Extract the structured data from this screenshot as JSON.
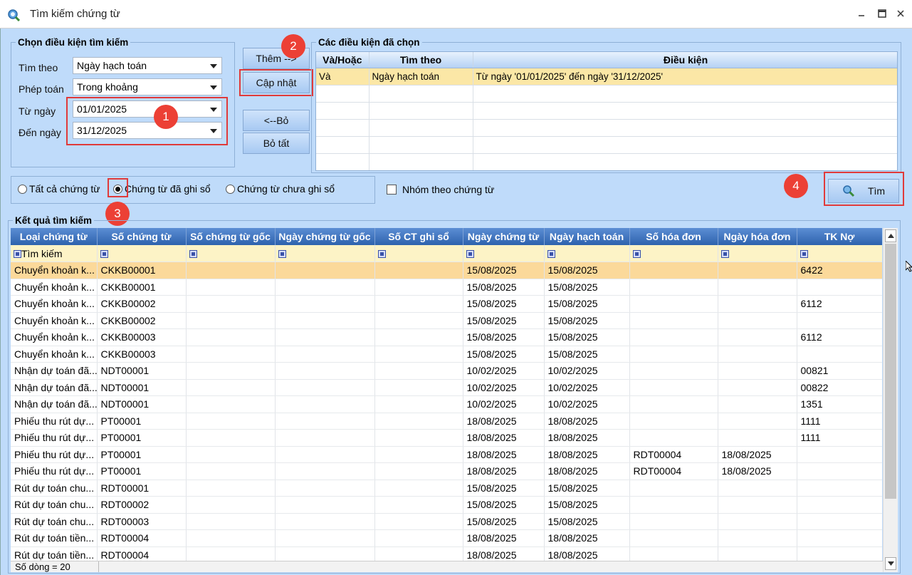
{
  "window": {
    "title": "Tìm kiếm chứng từ"
  },
  "criteria": {
    "legend": "Chọn điều kiện tìm kiếm",
    "tim_theo_label": "Tìm theo",
    "tim_theo_value": "Ngày hạch toán",
    "phep_toan_label": "Phép toán",
    "phep_toan_value": "Trong khoảng",
    "tu_ngay_label": "Từ ngày",
    "tu_ngay_value": "01/01/2025",
    "den_ngay_label": "Đến ngày",
    "den_ngay_value": "31/12/2025"
  },
  "buttons": {
    "them": "Thêm -->",
    "cap_nhat": "Cập nhật",
    "bo": "<--Bỏ",
    "bo_tat": "Bỏ tất",
    "tim": "Tìm"
  },
  "chosen": {
    "legend": "Các điều kiện đã chọn",
    "headers": [
      "Và/Hoặc",
      "Tìm theo",
      "Điều kiện"
    ],
    "rows": [
      [
        "Và",
        "Ngày hạch toán",
        "Từ ngày '01/01/2025' đến ngày '31/12/2025'"
      ]
    ]
  },
  "filter_options": {
    "all": "Tất cả chứng từ",
    "posted": "Chứng từ đã ghi sổ",
    "unposted": "Chứng từ chưa ghi sổ",
    "group": "Nhóm theo chứng từ",
    "selected": "posted"
  },
  "badges": [
    "1",
    "2",
    "3",
    "4"
  ],
  "results": {
    "legend": "Kết quả tìm kiếm",
    "headers": [
      "Loại chứng từ",
      "Số chứng từ",
      "Số chứng từ gốc",
      "Ngày chứng từ gốc",
      "Số CT ghi sổ",
      "Ngày chứng từ",
      "Ngày hạch toán",
      "Số hóa đơn",
      "Ngày hóa đơn",
      "TK Nợ"
    ],
    "filter_label": "Tìm kiếm",
    "rows": [
      [
        "Chuyển khoản k...",
        "CKKB00001",
        "",
        "",
        "",
        "15/08/2025",
        "15/08/2025",
        "",
        "",
        "6422"
      ],
      [
        "Chuyển khoản k...",
        "CKKB00001",
        "",
        "",
        "",
        "15/08/2025",
        "15/08/2025",
        "",
        "",
        ""
      ],
      [
        "Chuyển khoản k...",
        "CKKB00002",
        "",
        "",
        "",
        "15/08/2025",
        "15/08/2025",
        "",
        "",
        "6112"
      ],
      [
        "Chuyển khoản k...",
        "CKKB00002",
        "",
        "",
        "",
        "15/08/2025",
        "15/08/2025",
        "",
        "",
        ""
      ],
      [
        "Chuyển khoản k...",
        "CKKB00003",
        "",
        "",
        "",
        "15/08/2025",
        "15/08/2025",
        "",
        "",
        "6112"
      ],
      [
        "Chuyển khoản k...",
        "CKKB00003",
        "",
        "",
        "",
        "15/08/2025",
        "15/08/2025",
        "",
        "",
        ""
      ],
      [
        "Nhận dự toán đã...",
        "NDT00001",
        "",
        "",
        "",
        "10/02/2025",
        "10/02/2025",
        "",
        "",
        "00821"
      ],
      [
        "Nhận dự toán đã...",
        "NDT00001",
        "",
        "",
        "",
        "10/02/2025",
        "10/02/2025",
        "",
        "",
        "00822"
      ],
      [
        "Nhận dự toán đã...",
        "NDT00001",
        "",
        "",
        "",
        "10/02/2025",
        "10/02/2025",
        "",
        "",
        "1351"
      ],
      [
        "Phiếu thu rút dự...",
        "PT00001",
        "",
        "",
        "",
        "18/08/2025",
        "18/08/2025",
        "",
        "",
        "1111"
      ],
      [
        "Phiếu thu rút dự...",
        "PT00001",
        "",
        "",
        "",
        "18/08/2025",
        "18/08/2025",
        "",
        "",
        "1111"
      ],
      [
        "Phiếu thu rút dự...",
        "PT00001",
        "",
        "",
        "",
        "18/08/2025",
        "18/08/2025",
        "RDT00004",
        "18/08/2025",
        ""
      ],
      [
        "Phiếu thu rút dự...",
        "PT00001",
        "",
        "",
        "",
        "18/08/2025",
        "18/08/2025",
        "RDT00004",
        "18/08/2025",
        ""
      ],
      [
        "Rút dự toán chu...",
        "RDT00001",
        "",
        "",
        "",
        "15/08/2025",
        "15/08/2025",
        "",
        "",
        ""
      ],
      [
        "Rút dự toán chu...",
        "RDT00002",
        "",
        "",
        "",
        "15/08/2025",
        "15/08/2025",
        "",
        "",
        ""
      ],
      [
        "Rút dự toán chu...",
        "RDT00003",
        "",
        "",
        "",
        "15/08/2025",
        "15/08/2025",
        "",
        "",
        ""
      ],
      [
        "Rút dự toán tiền...",
        "RDT00004",
        "",
        "",
        "",
        "18/08/2025",
        "18/08/2025",
        "",
        "",
        ""
      ],
      [
        "Rút dự toán tiền...",
        "RDT00004",
        "",
        "",
        "",
        "18/08/2025",
        "18/08/2025",
        "",
        "",
        ""
      ]
    ],
    "row_count": "Số dòng = 20"
  }
}
